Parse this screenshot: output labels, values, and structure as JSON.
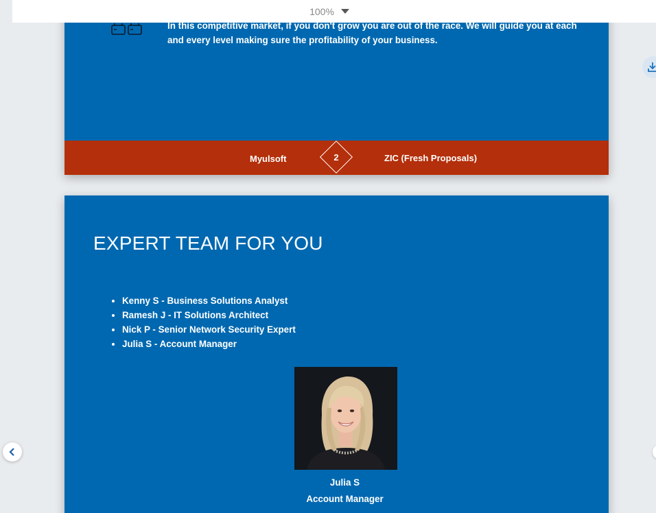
{
  "toolbar": {
    "zoom_level": "100%",
    "zoom_icon": "caret-down-icon"
  },
  "page1": {
    "icon": "battery-icon",
    "body_text": "In this competitive market, if you don't grow you are out of the race. We will guide you at each and every level making sure the profitability of your business.",
    "footer": {
      "left_text": "Myulsoft",
      "page_number": "2",
      "right_text": "ZIC (Fresh Proposals)"
    }
  },
  "page2": {
    "title": "EXPERT TEAM FOR YOU",
    "team": [
      "Kenny S - Business Solutions Analyst",
      "Ramesh J - IT Solutions Architect",
      "Nick P - Senior Network Security Expert",
      "Julia S - Account Manager"
    ],
    "photo": {
      "name": "Julia S",
      "role": "Account Manager"
    }
  },
  "controls": {
    "download_icon": "download-icon",
    "prev_icon": "chevron-left-icon"
  },
  "colors": {
    "page_blue": "#0068b0",
    "footer_red": "#b42f0b",
    "background": "#e9ecef"
  }
}
